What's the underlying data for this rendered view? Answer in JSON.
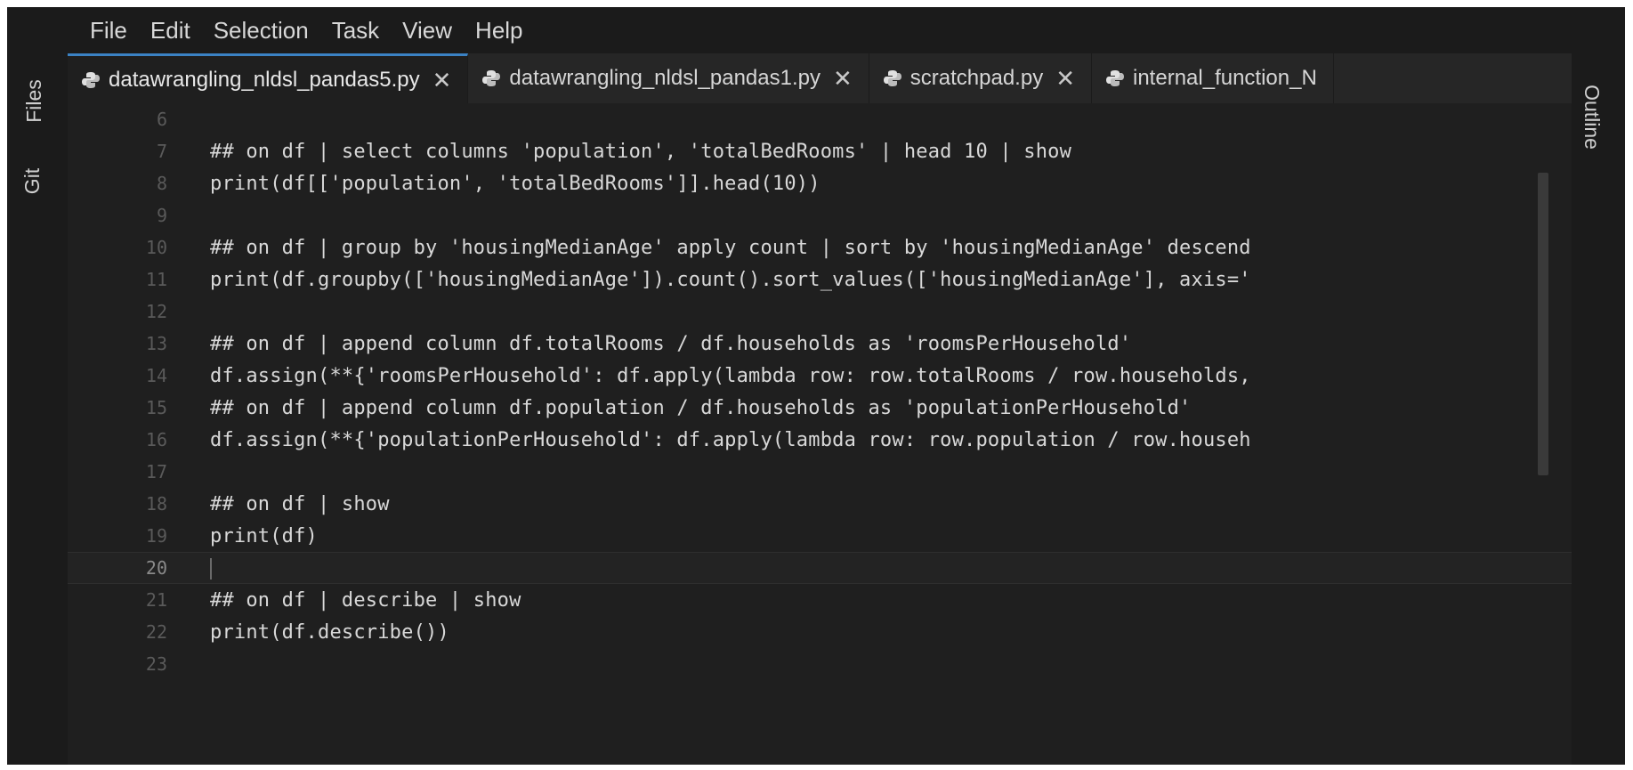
{
  "menu": {
    "file": "File",
    "edit": "Edit",
    "selection": "Selection",
    "task": "Task",
    "view": "View",
    "help": "Help"
  },
  "left_rail": {
    "files": "Files",
    "git": "Git"
  },
  "right_rail": {
    "outline": "Outline"
  },
  "tabs": [
    {
      "label": "datawrangling_nldsl_pandas5.py",
      "active": true,
      "close": "✕"
    },
    {
      "label": "datawrangling_nldsl_pandas1.py",
      "active": false,
      "close": "✕"
    },
    {
      "label": "scratchpad.py",
      "active": false,
      "close": "✕"
    },
    {
      "label": "internal_function_N",
      "active": false,
      "close": ""
    }
  ],
  "editor": {
    "current_line": "20",
    "lines": [
      {
        "num": "6",
        "text": ""
      },
      {
        "num": "7",
        "text": "## on df | select columns 'population', 'totalBedRooms' | head 10 | show"
      },
      {
        "num": "8",
        "text": "print(df[['population', 'totalBedRooms']].head(10))"
      },
      {
        "num": "9",
        "text": ""
      },
      {
        "num": "10",
        "text": "## on df | group by 'housingMedianAge' apply count | sort by 'housingMedianAge' descend"
      },
      {
        "num": "11",
        "text": "print(df.groupby(['housingMedianAge']).count().sort_values(['housingMedianAge'], axis='"
      },
      {
        "num": "12",
        "text": ""
      },
      {
        "num": "13",
        "text": "## on df | append column df.totalRooms / df.households as 'roomsPerHousehold'"
      },
      {
        "num": "14",
        "text": "df.assign(**{'roomsPerHousehold': df.apply(lambda row: row.totalRooms / row.households,"
      },
      {
        "num": "15",
        "text": "## on df | append column df.population / df.households as 'populationPerHousehold'"
      },
      {
        "num": "16",
        "text": "df.assign(**{'populationPerHousehold': df.apply(lambda row: row.population / row.househ"
      },
      {
        "num": "17",
        "text": ""
      },
      {
        "num": "18",
        "text": "## on df | show"
      },
      {
        "num": "19",
        "text": "print(df)"
      },
      {
        "num": "20",
        "text": ""
      },
      {
        "num": "21",
        "text": "## on df | describe | show"
      },
      {
        "num": "22",
        "text": "print(df.describe())"
      },
      {
        "num": "23",
        "text": ""
      }
    ]
  },
  "colors": {
    "background": "#1f1f1f",
    "chrome": "#1b1b1b",
    "tab_bg": "#262626",
    "text": "#d8d8d8",
    "line_numbers": "#5a5a5a",
    "python_icon": "#e0e0e0"
  },
  "icons": {
    "tab_icon": "python-file-icon",
    "tab_close": "close-icon"
  }
}
